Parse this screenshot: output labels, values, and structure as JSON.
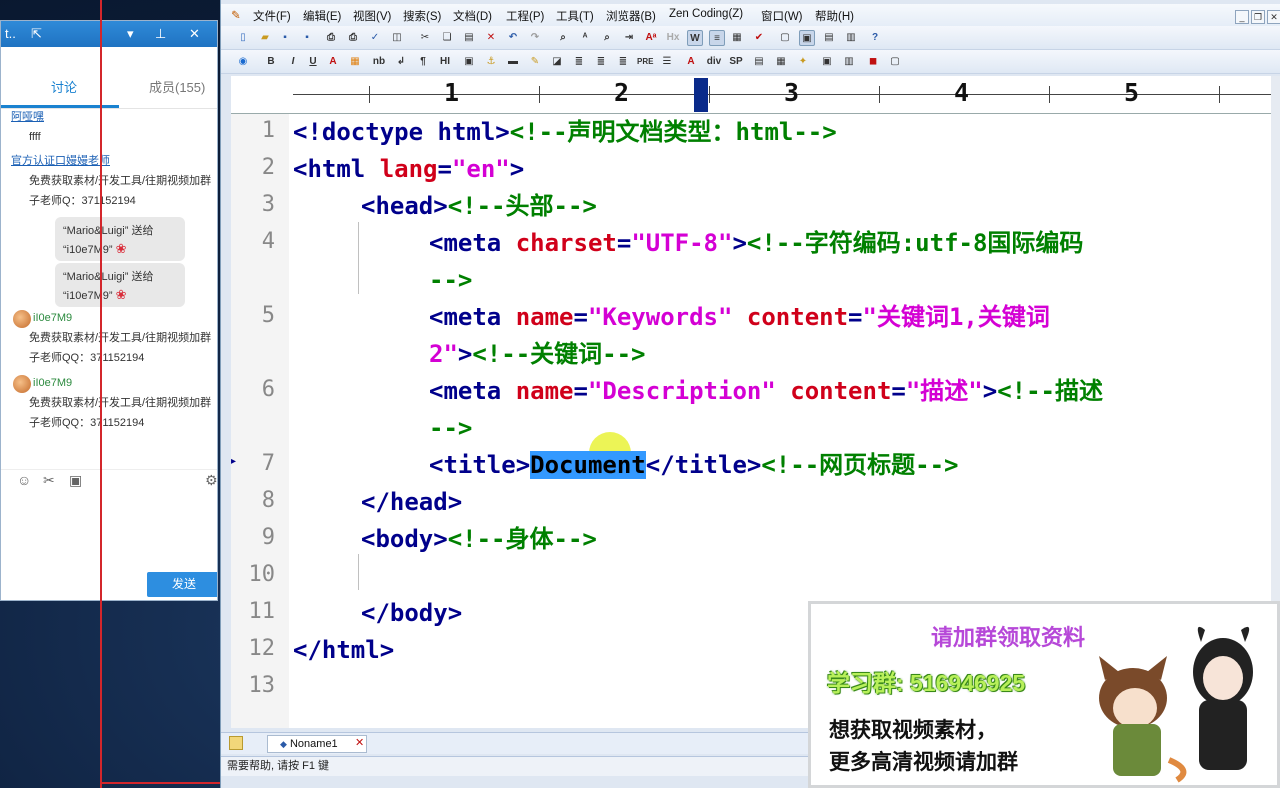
{
  "chat": {
    "tabs": [
      "讨论",
      "成员(155)"
    ],
    "messages": [
      {
        "sender": "阿哑嘿",
        "text": "ffff"
      },
      {
        "sender": "官方认证口嫚嫚老师",
        "lines": [
          "免费获取素材/开发工具/往期视频加群",
          "子老师Q：371152194"
        ]
      },
      {
        "gift": [
          "“Mario&Luigi” 送给",
          "“i10e7M9”"
        ]
      },
      {
        "gift": [
          "“Mario&Luigi” 送给",
          "“i10e7M9”"
        ]
      },
      {
        "sender": "iI0e7M9",
        "lines": [
          "免费获取素材/开发工具/往期视频加群",
          "子老师QQ：371152194"
        ]
      },
      {
        "sender": "iI0e7M9",
        "lines": [
          "免费获取素材/开发工具/往期视频加群",
          "子老师QQ：371152194"
        ]
      }
    ],
    "send_label": "发送"
  },
  "editor": {
    "menu": [
      "文件(F)",
      "编辑(E)",
      "视图(V)",
      "搜索(S)",
      "文档(D)",
      "工程(P)",
      "工具(T)",
      "浏览器(B)",
      "Zen Coding(Z)",
      "窗口(W)",
      "帮助(H)"
    ],
    "ruler_numbers": [
      "1",
      "2",
      "3",
      "4",
      "5"
    ],
    "line_numbers": [
      "1",
      "2",
      "3",
      "4",
      "5",
      "6",
      "7",
      "8",
      "9",
      "10",
      "11",
      "12",
      "13"
    ],
    "code": {
      "l1_a": "<!doctype html>",
      "l1_b": "<!--声明文档类型：html-->",
      "l2_a": "<html ",
      "l2_b": "lang",
      "l2_c": "=",
      "l2_d": "\"en\"",
      "l2_e": ">",
      "l3_a": "<head>",
      "l3_b": "<!--头部-->",
      "l4_a": "<meta ",
      "l4_b": "charset",
      "l4_c": "=",
      "l4_d": "\"UTF-8\"",
      "l4_e": ">",
      "l4_f": "<!--字符编码:utf-8国际编码",
      "l4_g": "-->",
      "l5_a": "<meta ",
      "l5_b": "name",
      "l5_c": "=",
      "l5_d": "\"Keywords\"",
      "l5_e": " content",
      "l5_f": "=",
      "l5_g": "\"关键词1,关键词",
      "l5_h": "2\"",
      "l5_i": ">",
      "l5_j": "<!--关键词-->",
      "l6_a": "<meta ",
      "l6_b": "name",
      "l6_c": "=",
      "l6_d": "\"Description\"",
      "l6_e": " content",
      "l6_f": "=",
      "l6_g": "\"描述\"",
      "l6_h": ">",
      "l6_i": "<!--描述",
      "l6_j": "-->",
      "l7_a": "<title>",
      "l7_b": "Document",
      "l7_c": "</title>",
      "l7_d": "<!--网页标题-->",
      "l8": "</head>",
      "l9_a": "<body>",
      "l9_b": "<!--身体-->",
      "l11": "</body>",
      "l12": "</html>"
    },
    "tab_label": "Noname1",
    "status": "需要帮助, 请按 F1 键"
  },
  "ad": {
    "title": "请加群领取资料",
    "group": "学习群: 516946925",
    "line1": "想获取视频素材，",
    "line2": "更多高清视频请加群"
  }
}
